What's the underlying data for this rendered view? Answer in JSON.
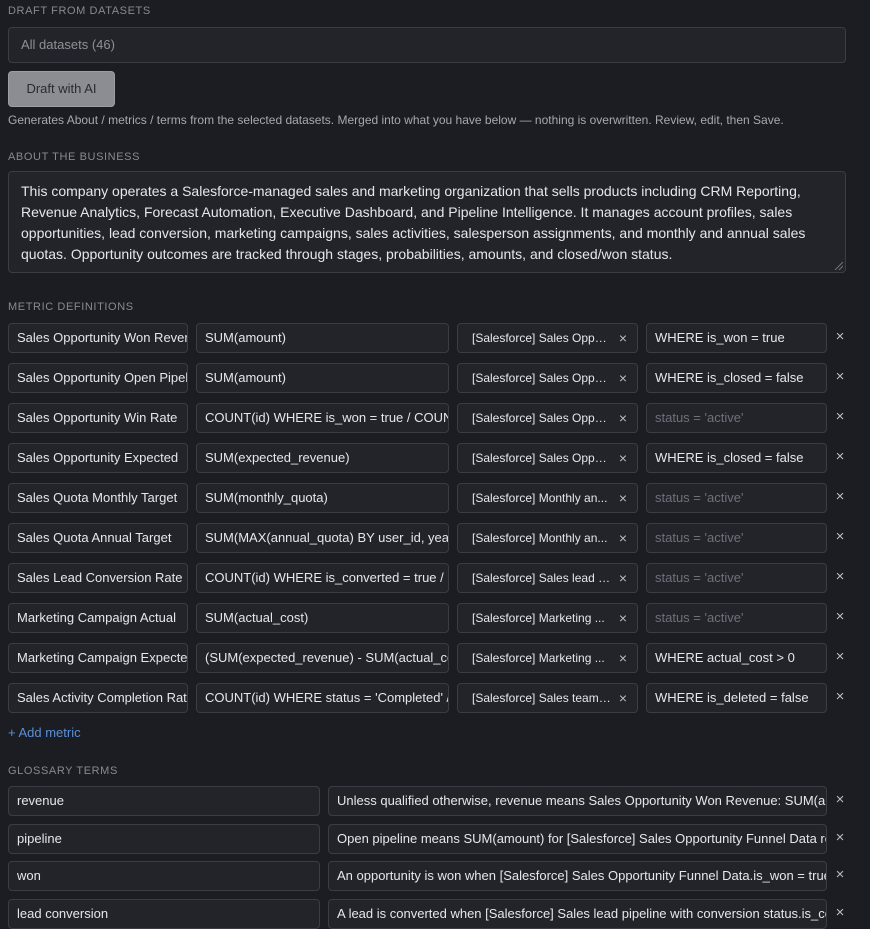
{
  "draft": {
    "section_label": "DRAFT FROM DATASETS",
    "dataset_select_value": "All datasets (46)",
    "button_label": "Draft with AI",
    "help_text": "Generates About / metrics / terms from the selected datasets. Merged into what you have below — nothing is overwritten. Review, edit, then Save."
  },
  "about": {
    "section_label": "ABOUT THE BUSINESS",
    "text": "This company operates a Salesforce-managed sales and marketing organization that sells products including CRM Reporting, Revenue Analytics, Forecast Automation, Executive Dashboard, and Pipeline Intelligence. It manages account profiles, sales opportunities, lead conversion, marketing campaigns, sales activities, salesperson assignments, and monthly and annual sales quotas. Opportunity outcomes are tracked through stages, probabilities, amounts, and closed/won status."
  },
  "metrics": {
    "section_label": "METRIC DEFINITIONS",
    "filter_placeholder": "status = 'active'",
    "add_label": "+ Add metric",
    "rows": [
      {
        "name": "Sales Opportunity Won Revenue",
        "expr": "SUM(amount)",
        "dataset": "[Salesforce] Sales Oppo...",
        "filter": "WHERE is_won = true"
      },
      {
        "name": "Sales Opportunity Open Pipeline",
        "expr": "SUM(amount)",
        "dataset": "[Salesforce] Sales Oppo...",
        "filter": "WHERE is_closed = false"
      },
      {
        "name": "Sales Opportunity Win Rate",
        "expr": "COUNT(id) WHERE is_won = true / COUNT(id)",
        "dataset": "[Salesforce] Sales Oppo...",
        "filter": ""
      },
      {
        "name": "Sales Opportunity Expected",
        "expr": "SUM(expected_revenue)",
        "dataset": "[Salesforce] Sales Oppo...",
        "filter": "WHERE is_closed = false"
      },
      {
        "name": "Sales Quota Monthly Target",
        "expr": "SUM(monthly_quota)",
        "dataset": "[Salesforce] Monthly an...",
        "filter": ""
      },
      {
        "name": "Sales Quota Annual Target",
        "expr": "SUM(MAX(annual_quota) BY user_id, year)",
        "dataset": "[Salesforce] Monthly an...",
        "filter": ""
      },
      {
        "name": "Sales Lead Conversion Rate",
        "expr": "COUNT(id) WHERE is_converted = true / COUNT(id)",
        "dataset": "[Salesforce] Sales lead p...",
        "filter": ""
      },
      {
        "name": "Marketing Campaign Actual",
        "expr": "SUM(actual_cost)",
        "dataset": "[Salesforce] Marketing ...",
        "filter": ""
      },
      {
        "name": "Marketing Campaign Expected",
        "expr": "(SUM(expected_revenue) - SUM(actual_cost))",
        "dataset": "[Salesforce] Marketing ...",
        "filter": "WHERE actual_cost > 0"
      },
      {
        "name": "Sales Activity Completion Rate",
        "expr": "COUNT(id) WHERE status = 'Completed' / COUNT(id)",
        "dataset": "[Salesforce] Sales team ...",
        "filter": "WHERE is_deleted = false"
      }
    ]
  },
  "glossary": {
    "section_label": "GLOSSARY TERMS",
    "rows": [
      {
        "term": "revenue",
        "definition": "Unless qualified otherwise, revenue means Sales Opportunity Won Revenue: SUM(amount)"
      },
      {
        "term": "pipeline",
        "definition": "Open pipeline means SUM(amount) for [Salesforce] Sales Opportunity Funnel Data records"
      },
      {
        "term": "won",
        "definition": "An opportunity is won when [Salesforce] Sales Opportunity Funnel Data.is_won = true"
      },
      {
        "term": "lead conversion",
        "definition": "A lead is converted when [Salesforce] Sales lead pipeline with conversion status.is_converted = true"
      }
    ]
  },
  "icons": {
    "remove_chip": "×",
    "remove_row": "×"
  }
}
